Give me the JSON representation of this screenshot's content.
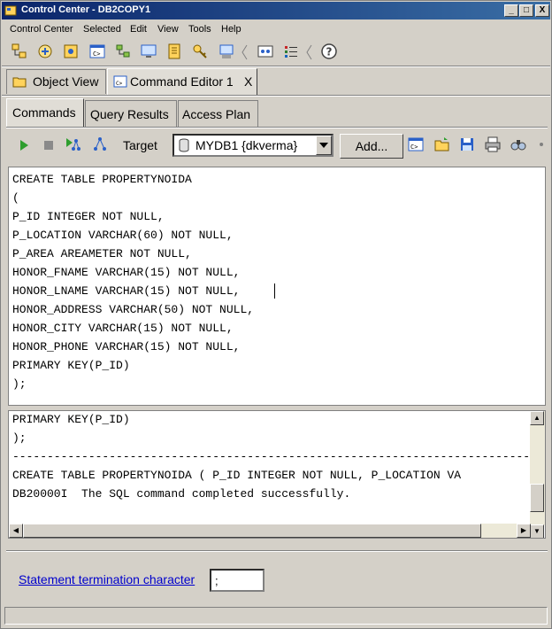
{
  "window": {
    "title": "Control Center - DB2COPY1",
    "buttons": {
      "minimize": "_",
      "maximize": "□",
      "close": "X"
    }
  },
  "menu": [
    "Control Center",
    "Selected",
    "Edit",
    "View",
    "Tools",
    "Help"
  ],
  "view_tabs": [
    {
      "label": "Object View"
    },
    {
      "label": "Command Editor 1"
    }
  ],
  "view_tab_close": "X",
  "editor_tabs": [
    "Commands",
    "Query Results",
    "Access Plan"
  ],
  "command_toolbar": {
    "target_label": "Target",
    "target_value": "MYDB1 {dkverma}",
    "add_label": "Add..."
  },
  "editor_lines": [
    "CREATE TABLE PROPERTYNOIDA",
    "(",
    "P_ID INTEGER NOT NULL,",
    "P_LOCATION VARCHAR(60) NOT NULL,",
    "P_AREA AREAMETER NOT NULL,",
    "HONOR_FNAME VARCHAR(15) NOT NULL,",
    "HONOR_LNAME VARCHAR(15) NOT NULL,",
    "HONOR_ADDRESS VARCHAR(50) NOT NULL,",
    "HONOR_CITY VARCHAR(15) NOT NULL,",
    "HONOR_PHONE VARCHAR(15) NOT NULL,",
    "PRIMARY KEY(P_ID)",
    ");"
  ],
  "result_lines": [
    "PRIMARY KEY(P_ID)",
    ");",
    "------------------------------------------------------------------------------",
    "CREATE TABLE PROPERTYNOIDA ( P_ID INTEGER NOT NULL, P_LOCATION VA",
    "DB20000I  The SQL command completed successfully."
  ],
  "termination": {
    "label": "Statement termination character",
    "value": ";"
  }
}
